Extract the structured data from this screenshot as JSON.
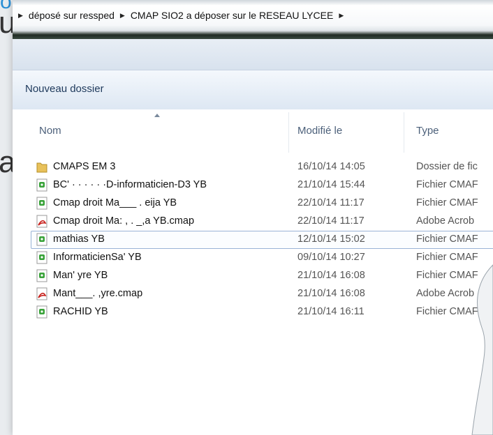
{
  "backdrop": {
    "link_text": "oh",
    "letter_1": "u",
    "letter_2": "a"
  },
  "address": {
    "crumbs": [
      "déposé sur ressped",
      "CMAP SIO2 a déposer sur le RESEAU LYCEE"
    ]
  },
  "toolbar": {
    "new_folder_label": "Nouveau dossier"
  },
  "columns": {
    "name": "Nom",
    "date": "Modifié le",
    "type": "Type"
  },
  "files": [
    {
      "name": "CMAPS EM 3",
      "date": "16/10/14 14:05",
      "type": "Dossier de fic",
      "icon": "folder-icon"
    },
    {
      "name": "BC'   ·  ·  ·  ·    ·  ·D-informaticien-D3 YB",
      "date": "21/10/14 15:44",
      "type": "Fichier CMAF",
      "icon": "cmap-file-icon"
    },
    {
      "name": "Cmap droit Ma___ . eija  YB",
      "date": "22/10/14 11:17",
      "type": "Fichier CMAF",
      "icon": "cmap-file-icon"
    },
    {
      "name": "Cmap droit Ma:     ,  . _,a YB.cmap",
      "date": "22/10/14 11:17",
      "type": "Adobe Acrob",
      "icon": "pdf-file-icon"
    },
    {
      "name": "              mathias  YB",
      "date": "12/10/14 15:02",
      "type": "Fichier CMAF",
      "icon": "cmap-file-icon",
      "selected": true
    },
    {
      "name": "InformaticienSa'        YB",
      "date": "09/10/14 10:27",
      "type": "Fichier CMAF",
      "icon": "cmap-file-icon"
    },
    {
      "name": "Man'              yre  YB",
      "date": "21/10/14 16:08",
      "type": "Fichier CMAF",
      "icon": "cmap-file-icon"
    },
    {
      "name": "Mant___.       ,yre.cmap",
      "date": "21/10/14 16:08",
      "type": "Adobe Acrob",
      "icon": "pdf-file-icon"
    },
    {
      "name": "RACHID  YB",
      "date": "21/10/14 16:11",
      "type": "Fichier CMAF",
      "icon": "cmap-file-icon"
    }
  ],
  "colors": {
    "link_blue": "#2a8fd6",
    "header_text": "#4c607a",
    "folder_yellow": "#e8c15a",
    "pdf_red": "#c8241f",
    "cmap_green": "#3aa33a"
  }
}
